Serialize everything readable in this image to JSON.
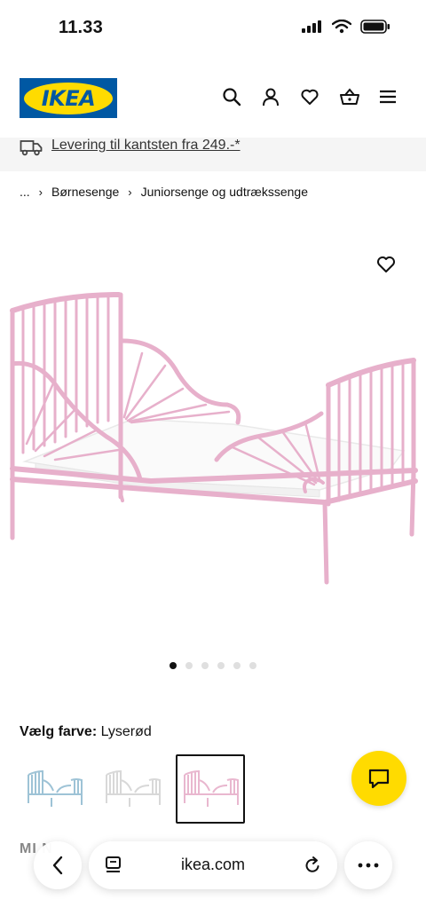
{
  "status_bar": {
    "time": "11.33"
  },
  "header": {
    "logo_text": "IKEA"
  },
  "delivery": {
    "text": "Levering til kantsten fra 249.-*"
  },
  "breadcrumb": {
    "items": [
      "...",
      "Børnesenge",
      "Juniorsenge og udtrækssenge"
    ]
  },
  "carousel": {
    "total_slides": 6,
    "active_index": 0
  },
  "color_picker": {
    "label": "Vælg farve:",
    "value": "Lyserød",
    "swatch_colors": [
      "#9ec3d6",
      "#e8e8e8",
      "#e9b7cf"
    ],
    "selected_index": 2
  },
  "product_peek": {
    "name": "MI N"
  },
  "browser": {
    "url": "ikea.com"
  },
  "colors": {
    "ikea_blue": "#0058a3",
    "ikea_yellow": "#ffdb00",
    "bed_pink": "#eab5cf"
  }
}
